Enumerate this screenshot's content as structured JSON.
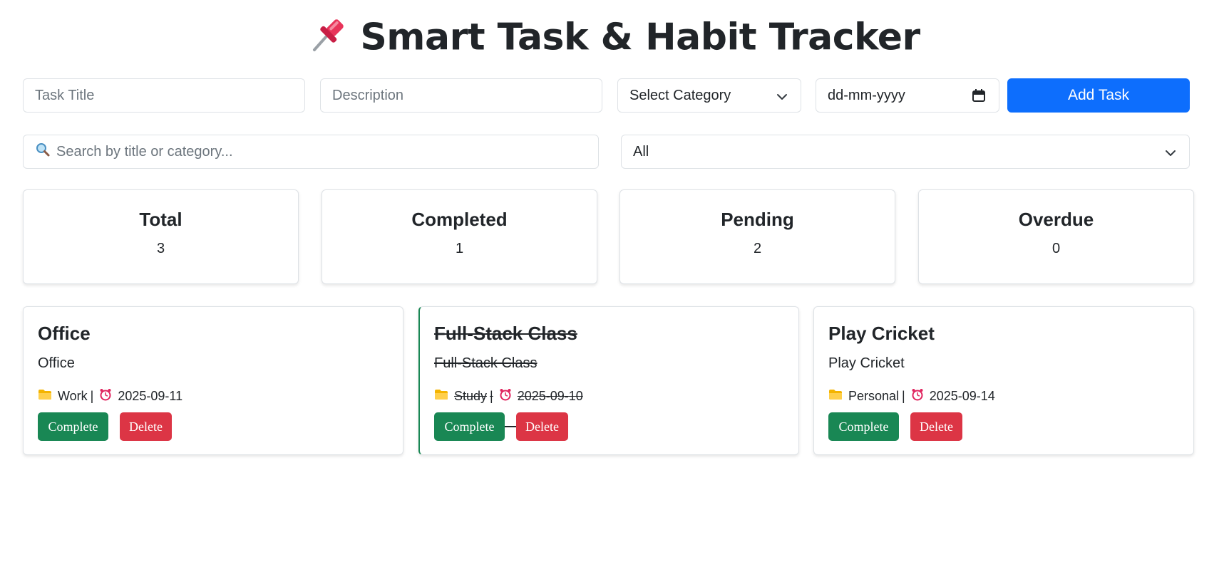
{
  "header": {
    "title": "Smart Task & Habit Tracker",
    "icon": "pushpin-icon"
  },
  "form": {
    "title_placeholder": "Task Title",
    "description_placeholder": "Description",
    "category_value": "Select Category",
    "date_placeholder": "dd-mm-yyyy",
    "add_button": "Add Task"
  },
  "filters": {
    "search_placeholder": "Search by title or category...",
    "status_value": "All"
  },
  "stats": [
    {
      "label": "Total",
      "value": "3"
    },
    {
      "label": "Completed",
      "value": "1"
    },
    {
      "label": "Pending",
      "value": "2"
    },
    {
      "label": "Overdue",
      "value": "0"
    }
  ],
  "tasks": [
    {
      "title": "Office",
      "description": "Office",
      "category": "Work",
      "due": "2025-09-11",
      "completed": false,
      "complete_label": "Complete",
      "delete_label": "Delete"
    },
    {
      "title": "Full-Stack Class",
      "description": "Full-Stack Class",
      "category": "Study",
      "due": "2025-09-10",
      "completed": true,
      "complete_label": "Complete",
      "delete_label": "Delete"
    },
    {
      "title": "Play Cricket",
      "description": "Play Cricket",
      "category": "Personal",
      "due": "2025-09-14",
      "completed": false,
      "complete_label": "Complete",
      "delete_label": "Delete"
    }
  ],
  "colors": {
    "primary": "#0d6efd",
    "success": "#198754",
    "danger": "#dc3545",
    "border": "#dee2e6"
  }
}
